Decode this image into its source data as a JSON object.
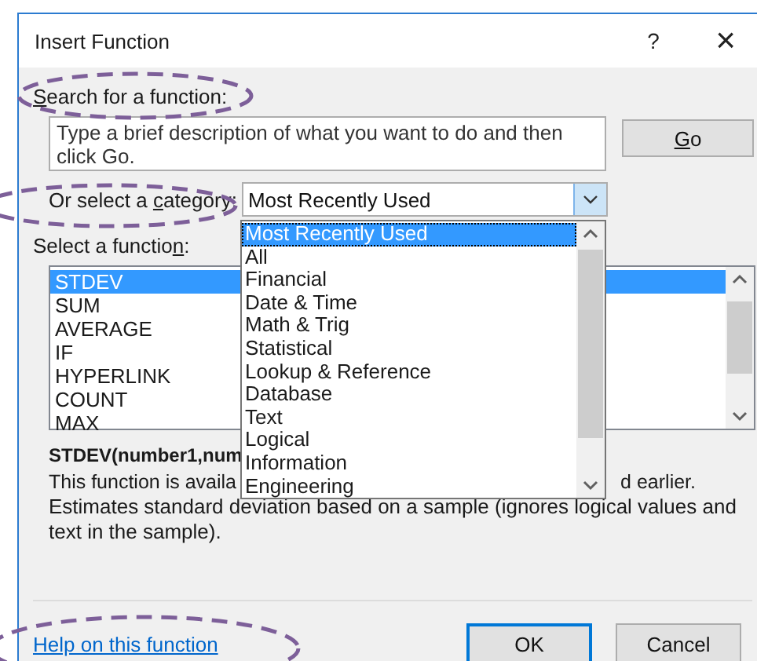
{
  "dialog": {
    "title": "Insert Function",
    "help_button": "?",
    "close_button": "×"
  },
  "search": {
    "label": {
      "key": "S",
      "after": "earch for a function:"
    },
    "value": "Type a brief description of what you want to do and then click Go.",
    "go_button": {
      "key": "G",
      "after": "o"
    }
  },
  "category": {
    "label": {
      "before": "Or select a ",
      "key": "c",
      "after": "ategory:"
    },
    "value": "Most Recently Used",
    "expanded": true,
    "options": [
      {
        "label": "Most Recently Used",
        "selected": true
      },
      {
        "label": "All",
        "selected": false
      },
      {
        "label": "Financial",
        "selected": false
      },
      {
        "label": "Date & Time",
        "selected": false
      },
      {
        "label": "Math & Trig",
        "selected": false
      },
      {
        "label": "Statistical",
        "selected": false
      },
      {
        "label": "Lookup & Reference",
        "selected": false
      },
      {
        "label": "Database",
        "selected": false
      },
      {
        "label": "Text",
        "selected": false
      },
      {
        "label": "Logical",
        "selected": false
      },
      {
        "label": "Information",
        "selected": false
      },
      {
        "label": "Engineering",
        "selected": false
      }
    ]
  },
  "functions": {
    "label": {
      "before": "Select a functio",
      "key": "n",
      "after": ":"
    },
    "items": [
      {
        "name": "STDEV",
        "selected": true
      },
      {
        "name": "SUM",
        "selected": false
      },
      {
        "name": "AVERAGE",
        "selected": false
      },
      {
        "name": "IF",
        "selected": false
      },
      {
        "name": "HYPERLINK",
        "selected": false
      },
      {
        "name": "COUNT",
        "selected": false
      },
      {
        "name": "MAX",
        "selected": false
      }
    ]
  },
  "signature": "STDEV(number1,num",
  "description": {
    "line_start": "This function is availa",
    "line_end": "d earlier.",
    "text": "Estimates standard deviation based on a sample (ignores logical values and text in the sample)."
  },
  "help_link": "Help on this function",
  "buttons": [
    {
      "label": "OK",
      "default": true
    },
    {
      "label": "Cancel",
      "default": false
    }
  ]
}
